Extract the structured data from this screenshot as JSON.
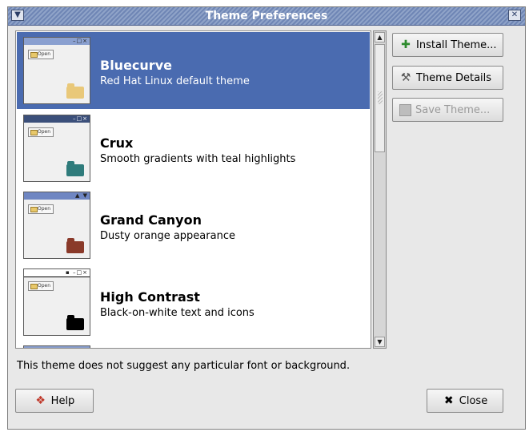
{
  "window": {
    "title": "Theme Preferences",
    "menu_icon": "chevron-down-icon",
    "close_icon": "close-icon"
  },
  "themes": [
    {
      "name": "Bluecurve",
      "description": "Red Hat Linux default theme",
      "selected": true,
      "folder_color": "#e9c879"
    },
    {
      "name": "Crux",
      "description": "Smooth gradients with teal highlights",
      "selected": false,
      "folder_color": "#2f7b7b"
    },
    {
      "name": "Grand Canyon",
      "description": "Dusty orange appearance",
      "selected": false,
      "folder_color": "#8a3a2a"
    },
    {
      "name": "High Contrast",
      "description": "Black-on-white text and icons",
      "selected": false,
      "folder_color": "#000000"
    }
  ],
  "thumb_open_label": "Open",
  "buttons": {
    "install": "Install Theme...",
    "details": "Theme Details",
    "save": "Save Theme...",
    "help": "Help",
    "close": "Close"
  },
  "info_text": "This theme does not suggest any particular font or background.",
  "colors": {
    "selection": "#4a6bb0",
    "titlebar": "#7a8fbf"
  }
}
